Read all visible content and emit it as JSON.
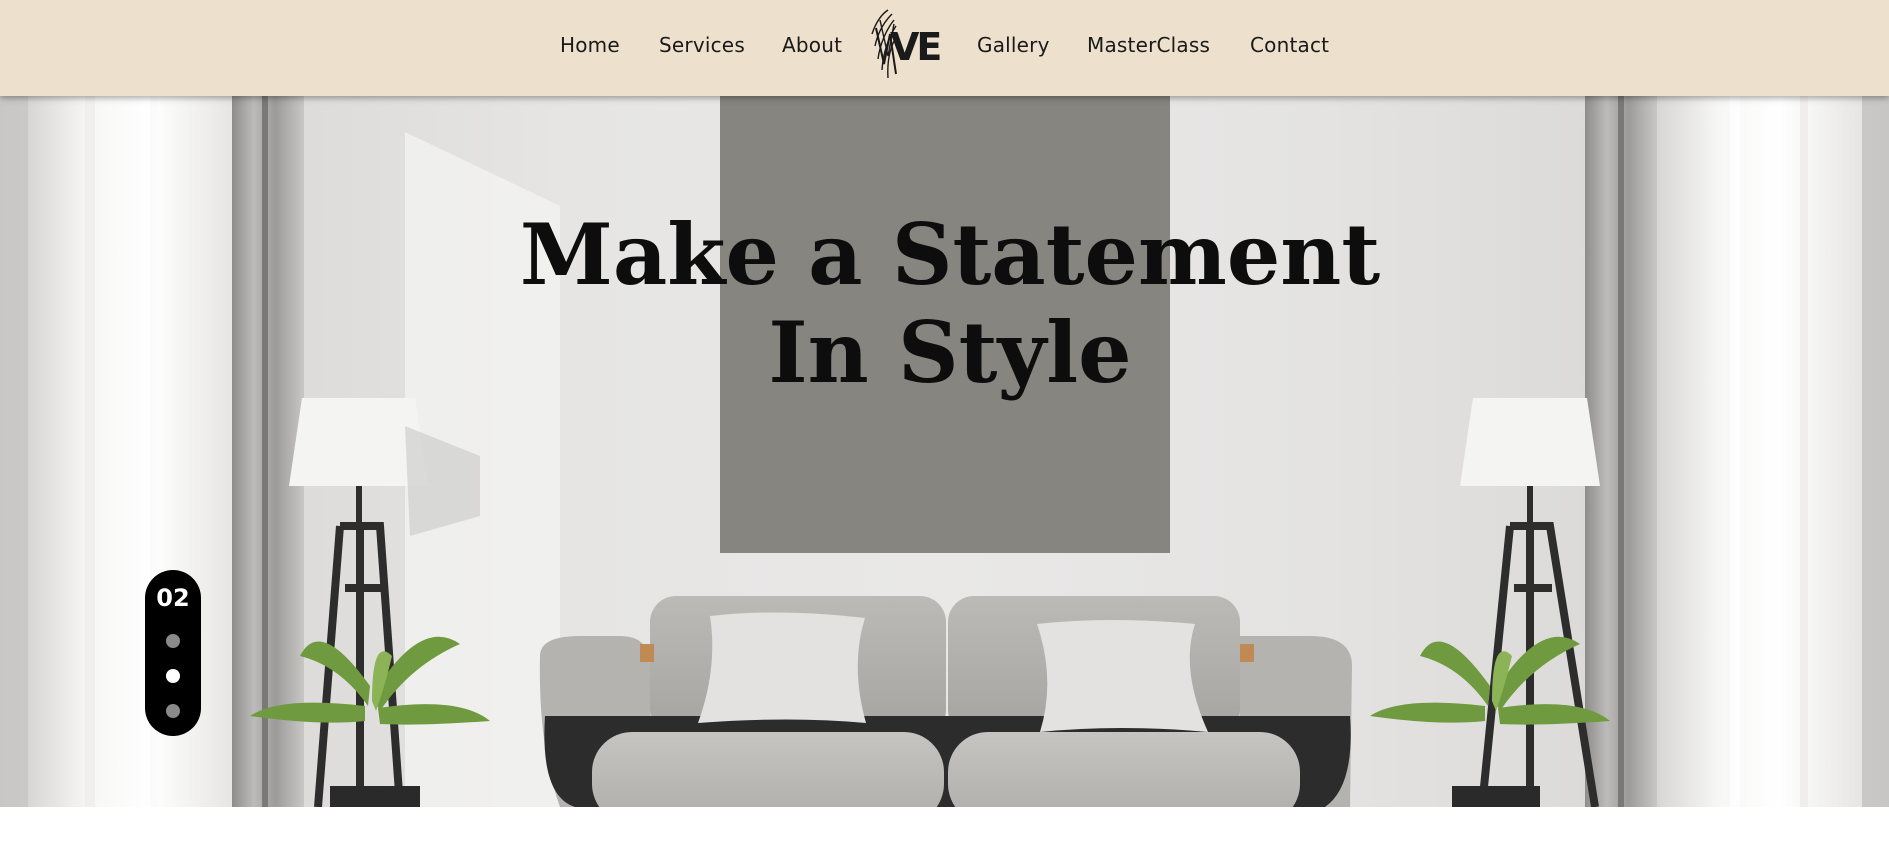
{
  "nav": {
    "left": [
      "Home",
      "Services",
      "About"
    ],
    "right": [
      "Gallery",
      "MasterClass",
      "Contact"
    ],
    "logo_text": "VE"
  },
  "hero": {
    "title_line1": "Make a Statement",
    "title_line2": "In Style"
  },
  "slider": {
    "current": "02",
    "dots": 3,
    "active_index": 1
  },
  "colors": {
    "header_bg": "#ede0cc",
    "hero_box": "#868580",
    "title": "#0d0d0d",
    "pill": "#000000"
  }
}
